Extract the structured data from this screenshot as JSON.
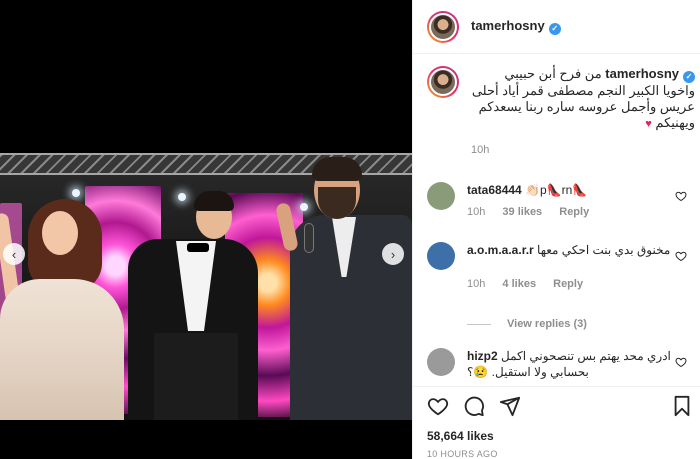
{
  "post": {
    "username": "tamerhosny",
    "verified_glyph": "✓",
    "caption_text": "من فرح أبن حبيبي واخويا الكبير النجم مصطفى قمر أياد أحلى عريس وأجمل عروسه ساره ربنا يسعدكم ويهنيكم",
    "caption_emoji": "♥",
    "caption_age": "10h",
    "likes_count": "58,664 likes",
    "posted_ago": "10 HOURS AGO"
  },
  "media": {
    "prev_glyph": "‹",
    "next_glyph": "›"
  },
  "comments": [
    {
      "username": "tata68444",
      "text": "👏🏻p👠rn👠",
      "age": "10h",
      "likes": "39 likes",
      "reply_label": "Reply",
      "avatar_color": "#8a9b7a"
    },
    {
      "username": "a.o.m.a.a.r.r",
      "text": "مخنوق بدي بنت احكي معها",
      "age": "10h",
      "likes": "4 likes",
      "reply_label": "Reply",
      "view_replies": "View replies (3)",
      "avatar_color": "#3d6fa8"
    },
    {
      "username": "hizp2",
      "text": "ادري محد يهتم بس تنصحوني اكمل بحسابي ولا استقيل. 😢؟",
      "avatar_color": "#9a9a9a"
    }
  ],
  "icons": {
    "like": "heart-icon",
    "comment": "comment-icon",
    "share": "share-icon",
    "save": "bookmark-icon"
  }
}
